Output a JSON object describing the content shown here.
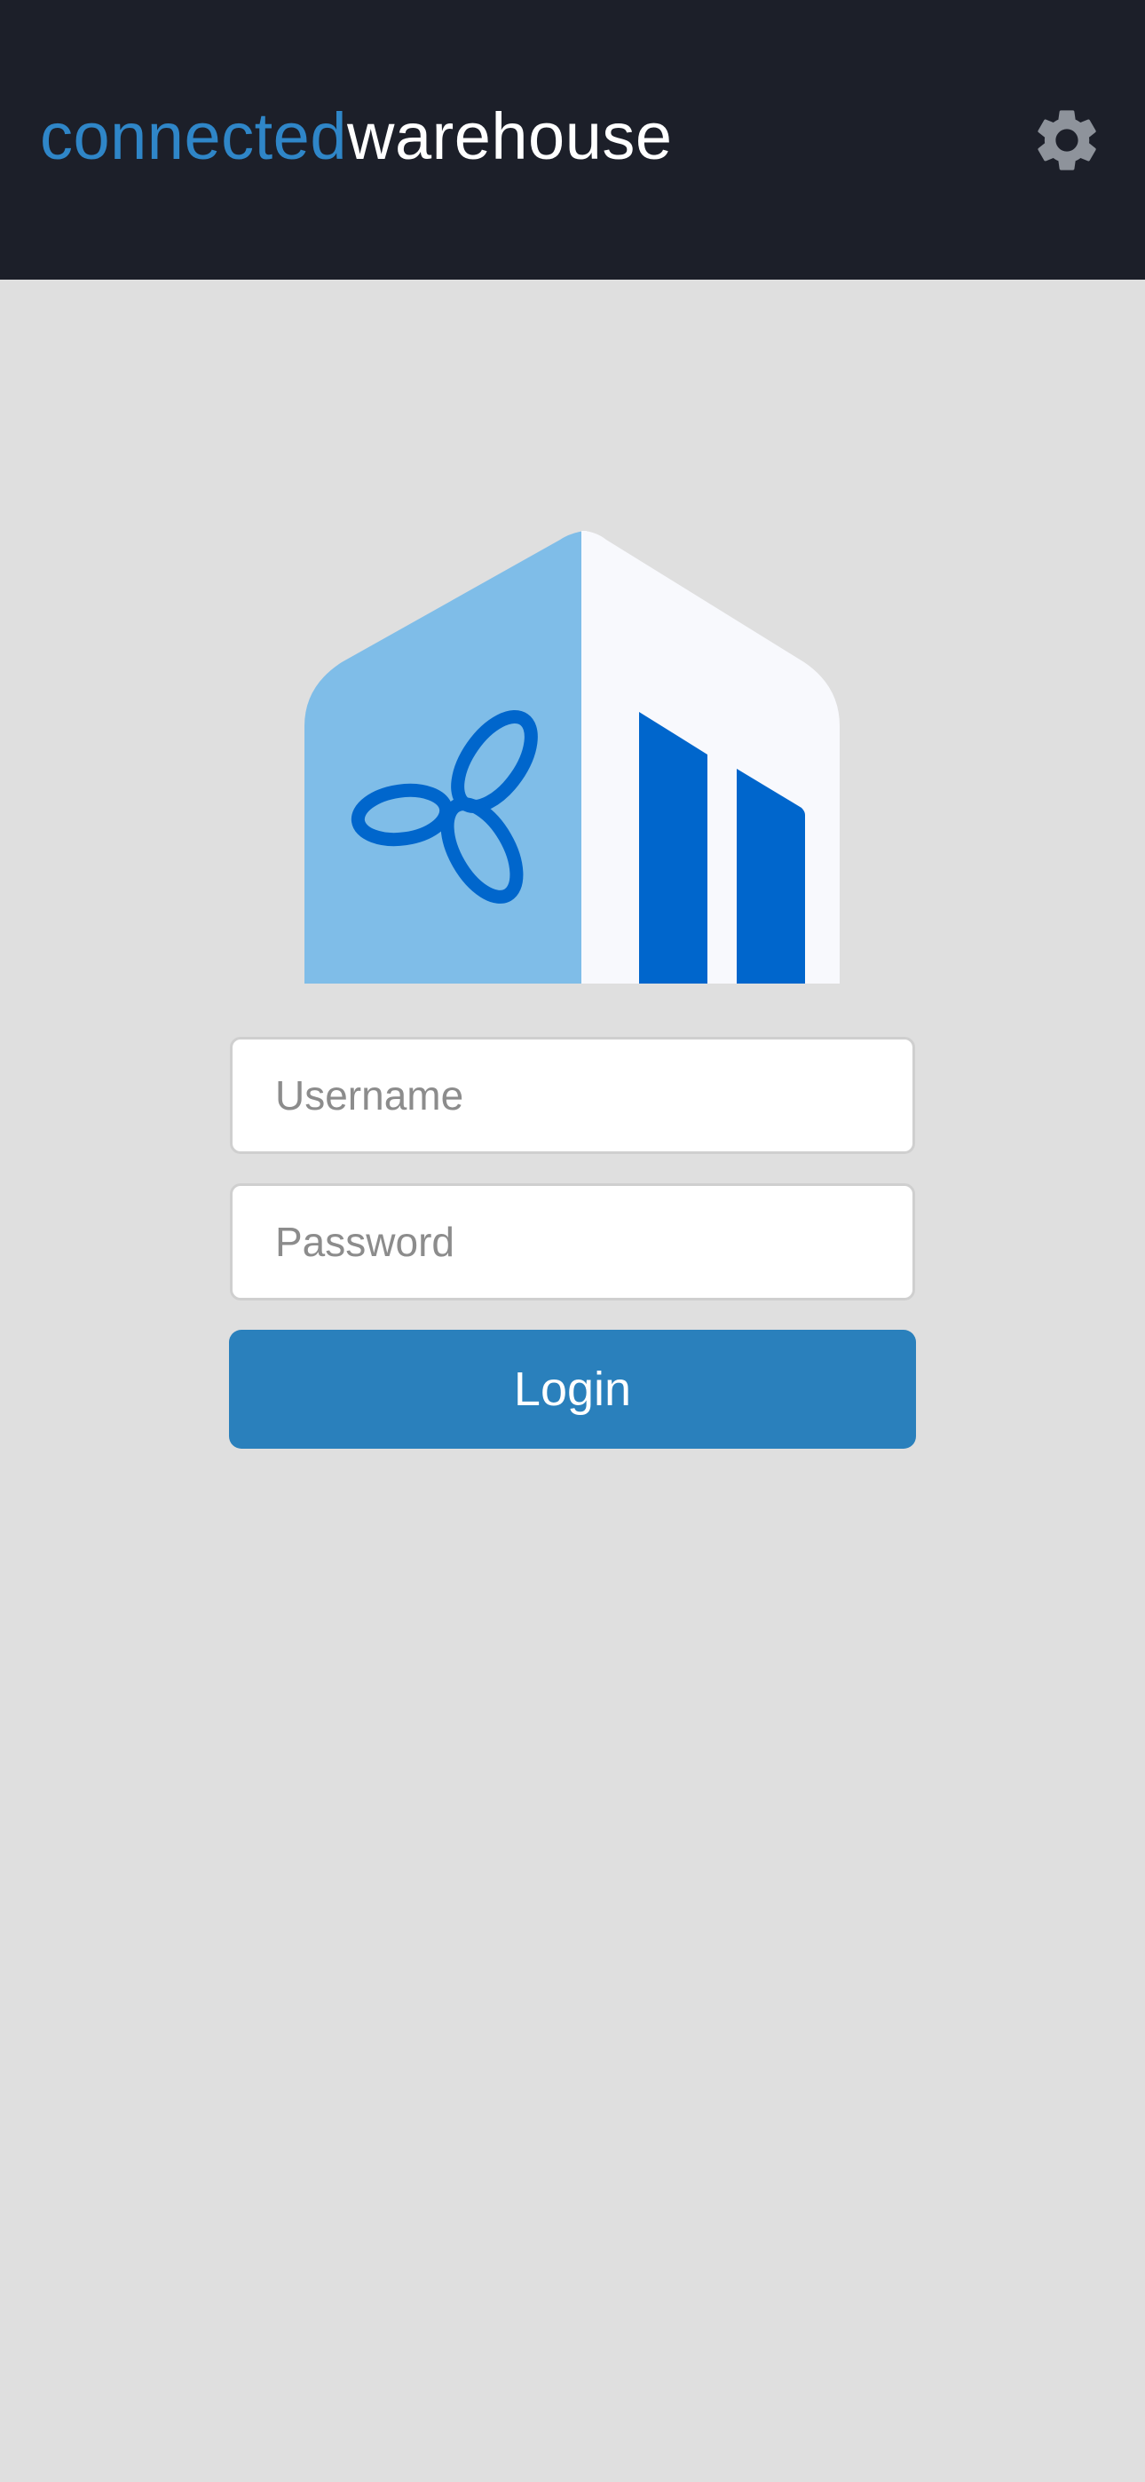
{
  "header": {
    "brand_part1": "connected",
    "brand_part2": "warehouse",
    "settings_icon": "gear-icon"
  },
  "logo": {
    "icon": "warehouse-logo-icon"
  },
  "form": {
    "username_placeholder": "Username",
    "username_value": "",
    "password_placeholder": "Password",
    "password_value": "",
    "login_label": "Login"
  },
  "colors": {
    "header_bg": "#1c1f29",
    "page_bg": "#dfdfdf",
    "brand_accent": "#2f86c8",
    "button": "#2a80bc",
    "logo_light_blue": "#7fbde8",
    "logo_dark_blue": "#0066cc",
    "gear": "#8e939b"
  }
}
